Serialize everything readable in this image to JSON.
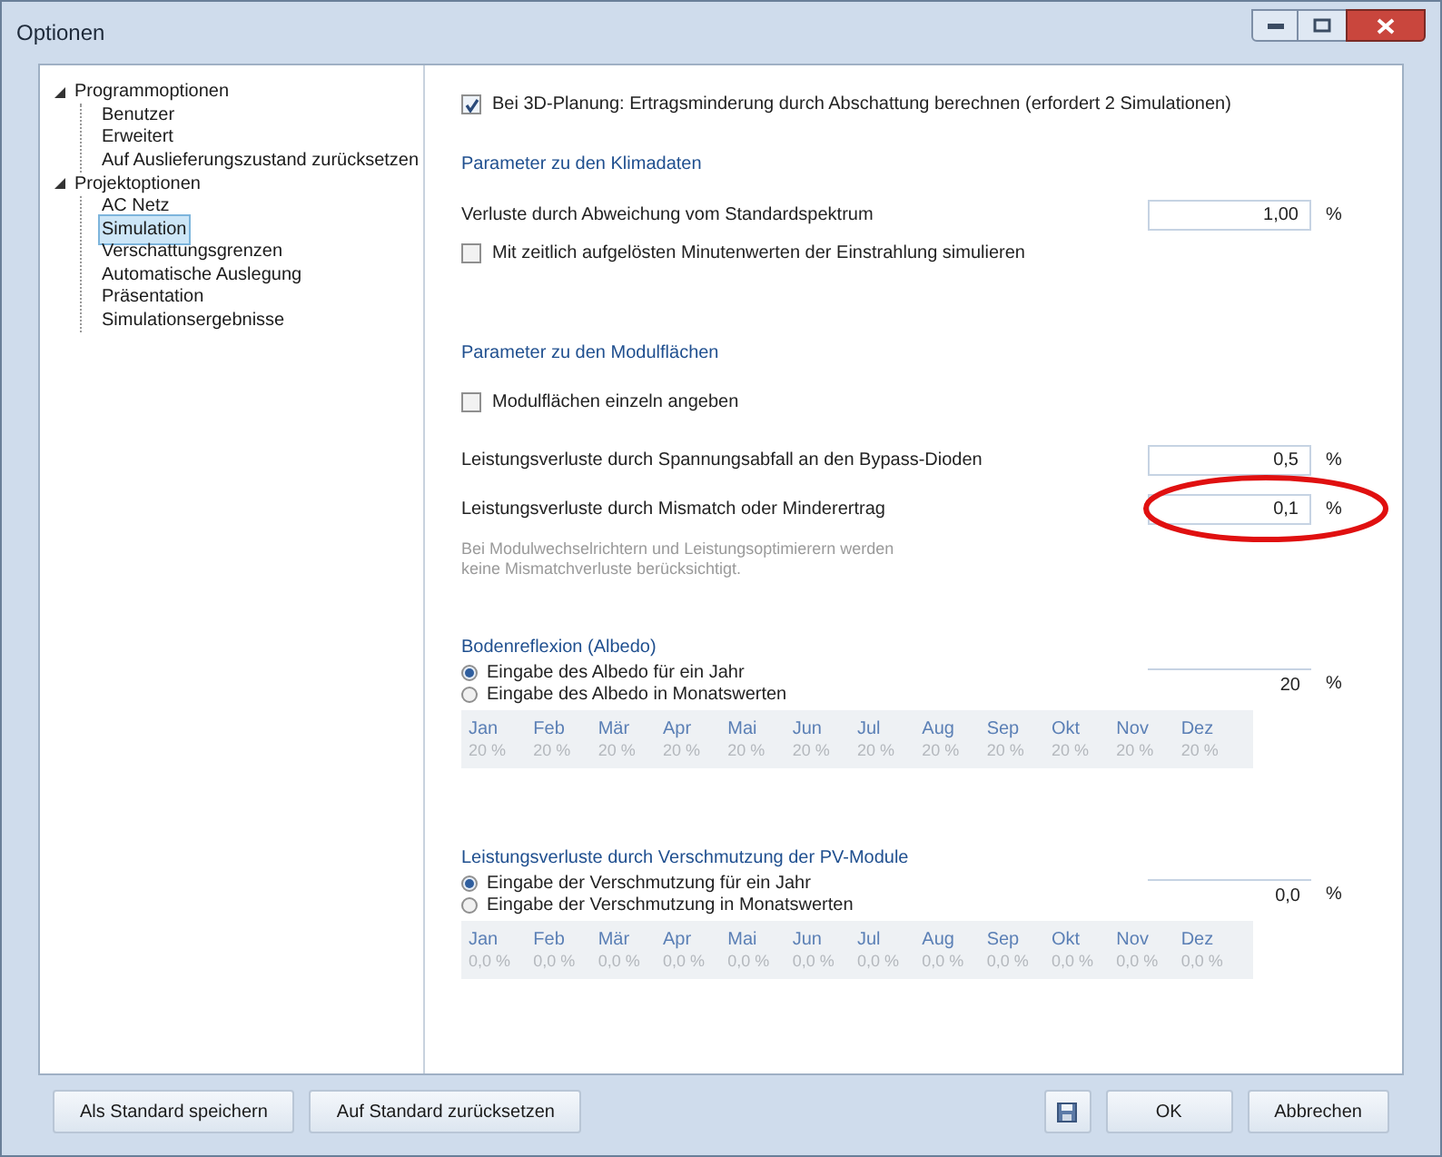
{
  "window": {
    "title": "Optionen"
  },
  "tree": [
    {
      "label": "Programmoptionen",
      "expanded": true,
      "selected": false,
      "children": [
        {
          "label": "Benutzer",
          "selected": false
        },
        {
          "label": "Erweitert",
          "selected": false
        },
        {
          "label": "Auf Auslieferungszustand zurücksetzen",
          "selected": false
        }
      ]
    },
    {
      "label": "Projektoptionen",
      "expanded": true,
      "selected": false,
      "children": [
        {
          "label": "AC Netz",
          "selected": false
        },
        {
          "label": "Simulation",
          "selected": true
        },
        {
          "label": "Verschattungsgrenzen",
          "selected": false
        },
        {
          "label": "Automatische Auslegung",
          "selected": false
        },
        {
          "label": "Präsentation",
          "selected": false
        },
        {
          "label": "Simulationsergebnisse",
          "selected": false
        }
      ]
    }
  ],
  "shading_check": {
    "label": "Bei 3D-Planung: Ertragsminderung durch Abschattung berechnen (erfordert 2 Simulationen)",
    "checked": true
  },
  "climate": {
    "heading": "Parameter zu den Klimadaten",
    "spectrum": {
      "label": "Verluste durch Abweichung vom Standardspektrum",
      "value": "1,00",
      "unit": "%"
    },
    "minute_check": {
      "label": "Mit zeitlich aufgelösten Minutenwerten der Einstrahlung simulieren",
      "checked": false
    }
  },
  "module": {
    "heading": "Parameter zu den Modulflächen",
    "individual_check": {
      "label": "Modulflächen einzeln angeben",
      "checked": false
    },
    "bypass": {
      "label": "Leistungsverluste durch Spannungsabfall an den Bypass-Dioden",
      "value": "0,5",
      "unit": "%"
    },
    "mismatch": {
      "label": "Leistungsverluste durch Mismatch oder Minderertrag",
      "value": "0,1",
      "unit": "%",
      "highlighted": true
    },
    "note": "Bei Modulwechselrichtern und Leistungsoptimierern werden keine Mismatchverluste berücksichtigt."
  },
  "albedo": {
    "heading": "Bodenreflexion (Albedo)",
    "options": [
      {
        "label": "Eingabe des Albedo für ein Jahr",
        "selected": true
      },
      {
        "label": "Eingabe des Albedo in Monatswerten",
        "selected": false
      }
    ],
    "value": "20",
    "unit": "%",
    "months_enabled": false,
    "months": [
      {
        "month": "Jan",
        "value": "20 %"
      },
      {
        "month": "Feb",
        "value": "20 %"
      },
      {
        "month": "Mär",
        "value": "20 %"
      },
      {
        "month": "Apr",
        "value": "20 %"
      },
      {
        "month": "Mai",
        "value": "20 %"
      },
      {
        "month": "Jun",
        "value": "20 %"
      },
      {
        "month": "Jul",
        "value": "20 %"
      },
      {
        "month": "Aug",
        "value": "20 %"
      },
      {
        "month": "Sep",
        "value": "20 %"
      },
      {
        "month": "Okt",
        "value": "20 %"
      },
      {
        "month": "Nov",
        "value": "20 %"
      },
      {
        "month": "Dez",
        "value": "20 %"
      }
    ]
  },
  "soiling": {
    "heading": "Leistungsverluste durch Verschmutzung der PV-Module",
    "options": [
      {
        "label": "Eingabe der Verschmutzung für ein Jahr",
        "selected": true
      },
      {
        "label": "Eingabe der Verschmutzung in Monatswerten",
        "selected": false
      }
    ],
    "value": "0,0",
    "unit": "%",
    "months_enabled": false,
    "months": [
      {
        "month": "Jan",
        "value": "0,0 %"
      },
      {
        "month": "Feb",
        "value": "0,0 %"
      },
      {
        "month": "Mär",
        "value": "0,0 %"
      },
      {
        "month": "Apr",
        "value": "0,0 %"
      },
      {
        "month": "Mai",
        "value": "0,0 %"
      },
      {
        "month": "Jun",
        "value": "0,0 %"
      },
      {
        "month": "Jul",
        "value": "0,0 %"
      },
      {
        "month": "Aug",
        "value": "0,0 %"
      },
      {
        "month": "Sep",
        "value": "0,0 %"
      },
      {
        "month": "Okt",
        "value": "0,0 %"
      },
      {
        "month": "Nov",
        "value": "0,0 %"
      },
      {
        "month": "Dez",
        "value": "0,0 %"
      }
    ]
  },
  "left_buttons": [
    {
      "kind": "text",
      "label": "Als Standard speichern"
    },
    {
      "kind": "text",
      "label": "Auf Standard zurücksetzen"
    }
  ],
  "right_buttons": [
    {
      "kind": "save"
    },
    {
      "kind": "text",
      "label": "OK"
    },
    {
      "kind": "text",
      "label": "Abbrechen"
    }
  ]
}
